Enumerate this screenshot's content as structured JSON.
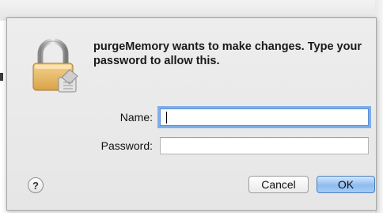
{
  "dialog": {
    "message": "purgeMemory wants to make changes. Type your password to allow this.",
    "name_label": "Name:",
    "name_value": "",
    "password_label": "Password:",
    "password_value": "",
    "help_label": "?",
    "cancel_label": "Cancel",
    "ok_label": "OK"
  },
  "icons": {
    "dialog_icon": "lock-icon"
  },
  "colors": {
    "focus_ring": "#7eaeea",
    "default_button": "#8dbcf0"
  }
}
